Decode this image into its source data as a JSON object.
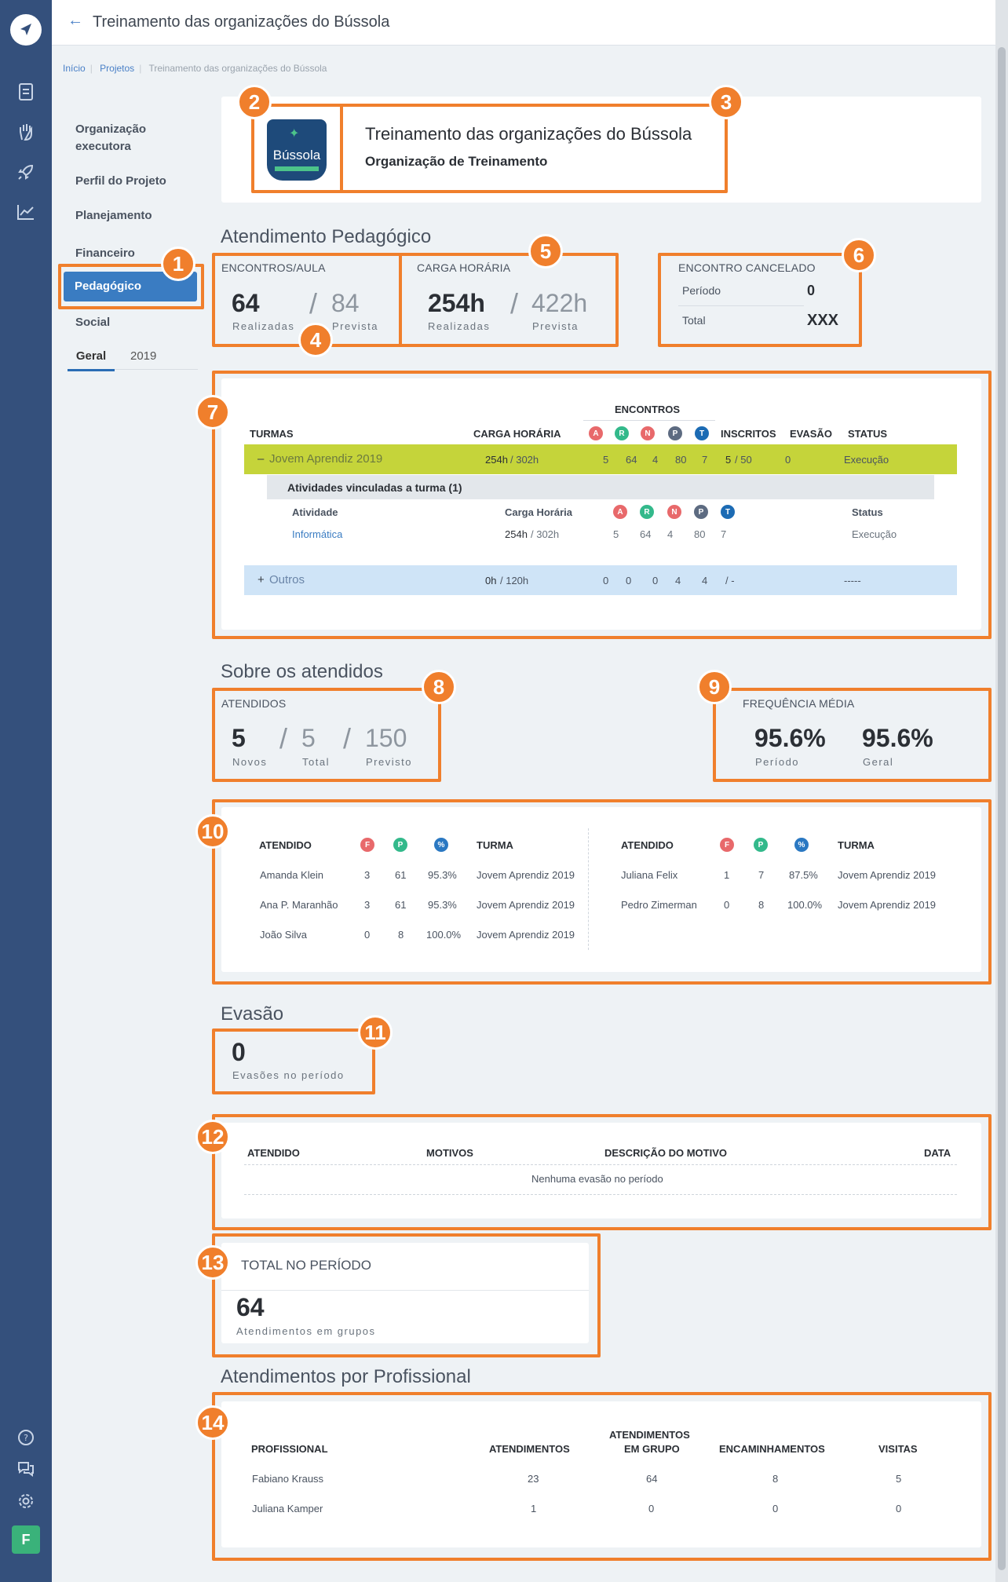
{
  "header": {
    "title": "Treinamento das organizações do Bússola"
  },
  "breadcrumb": [
    "Início",
    "Projetos",
    "Treinamento das organizações do Bússola"
  ],
  "menu": {
    "items": [
      "Organização executora",
      "Perfil do Projeto",
      "Planejamento",
      "Financeiro",
      "Pedagógico",
      "Social"
    ],
    "active": "Pedagógico",
    "toggle": [
      "Geral",
      "2019"
    ]
  },
  "org": {
    "logo_text": "Bússola",
    "name": "Treinamento das organizações do Bússola",
    "type": "Organização de Treinamento"
  },
  "atendimento": {
    "title": "Atendimento Pedagógico",
    "encontros": {
      "label": "ENCONTROS/AULA",
      "realizadas": "64",
      "prevista": "84",
      "realizadas_label": "Realizadas",
      "prevista_label": "Prevista"
    },
    "carga": {
      "label": "CARGA HORÁRIA",
      "realizadas": "254h",
      "prevista": "422h",
      "realizadas_label": "Realizadas",
      "prevista_label": "Prevista"
    },
    "cancelado": {
      "label": "ENCONTRO CANCELADO",
      "periodo_label": "Período",
      "periodo": "0",
      "total_label": "Total",
      "total": "XXX"
    }
  },
  "turmas": {
    "headers": {
      "turmas": "TURMAS",
      "carga": "CARGA HORÁRIA",
      "encontros": "ENCONTROS",
      "inscritos": "INSCRITOS",
      "evasao": "EVASÃO",
      "status": "STATUS"
    },
    "letters": [
      "A",
      "R",
      "N",
      "P",
      "T"
    ],
    "row1": {
      "toggle": "–",
      "name": "Jovem Aprendiz 2019",
      "carga_a": "254h",
      "carga_b": "/ 302h",
      "enc": [
        "5",
        "64",
        "4",
        "80",
        "7"
      ],
      "ins_a": "5",
      "ins_b": "/ 50",
      "evasao": "0",
      "status": "Execução"
    },
    "sub_title": "Atividades vinculadas a turma (1)",
    "sub_headers": {
      "atividade": "Atividade",
      "carga": "Carga Horária",
      "status": "Status"
    },
    "sub_row": {
      "name": "Informática",
      "carga_a": "254h",
      "carga_b": "/ 302h",
      "enc": [
        "5",
        "64",
        "4",
        "80",
        "7"
      ],
      "status": "Execução"
    },
    "row2": {
      "toggle": "+",
      "name": "Outros",
      "carga_a": "0h",
      "carga_b": "/ 120h",
      "enc": [
        "0",
        "0",
        "0",
        "4",
        "4"
      ],
      "ins": "/ -",
      "status": "-----"
    }
  },
  "sobre": {
    "title": "Sobre os atendidos",
    "atendidos": {
      "label": "ATENDIDOS",
      "novos": "5",
      "total": "5",
      "previsto": "150",
      "novos_label": "Novos",
      "total_label": "Total",
      "previsto_label": "Previsto"
    },
    "freq": {
      "label": "FREQUÊNCIA MÉDIA",
      "periodo": "95.6%",
      "geral": "95.6%",
      "periodo_label": "Período",
      "geral_label": "Geral"
    }
  },
  "atendidos_table": {
    "headers": {
      "atendido": "ATENDIDO",
      "f": "F",
      "p": "P",
      "pct": "%",
      "turma": "TURMA"
    },
    "left": [
      {
        "name": "Amanda Klein",
        "f": "3",
        "p": "61",
        "pct": "95.3%",
        "turma": "Jovem Aprendiz 2019"
      },
      {
        "name": "Ana P. Maranhão",
        "f": "3",
        "p": "61",
        "pct": "95.3%",
        "turma": "Jovem Aprendiz 2019"
      },
      {
        "name": "João Silva",
        "f": "0",
        "p": "8",
        "pct": "100.0%",
        "turma": "Jovem Aprendiz 2019"
      }
    ],
    "right": [
      {
        "name": "Juliana Felix",
        "f": "1",
        "p": "7",
        "pct": "87.5%",
        "turma": "Jovem Aprendiz 2019"
      },
      {
        "name": "Pedro Zimerman",
        "f": "0",
        "p": "8",
        "pct": "100.0%",
        "turma": "Jovem Aprendiz 2019"
      }
    ]
  },
  "evasao": {
    "title": "Evasão",
    "value": "0",
    "value_label": "Evasões no período",
    "headers": {
      "atendido": "ATENDIDO",
      "motivos": "MOTIVOS",
      "descricao": "DESCRIÇÃO DO MOTIVO",
      "data": "DATA"
    },
    "empty": "Nenhuma evasão no período"
  },
  "total": {
    "title": "TOTAL NO PERÍODO",
    "value": "64",
    "label": "Atendimentos em grupos"
  },
  "profissional": {
    "title": "Atendimentos por Profissional",
    "headers": {
      "profissional": "PROFISSIONAL",
      "atendimentos": "ATENDIMENTOS",
      "grupo_a": "ATENDIMENTOS",
      "grupo_b": "EM GRUPO",
      "encaminhamentos": "ENCAMINHAMENTOS",
      "visitas": "VISITAS"
    },
    "rows": [
      {
        "name": "Fabiano Krauss",
        "atendimentos": "23",
        "grupo": "64",
        "encaminhamentos": "8",
        "visitas": "5"
      },
      {
        "name": "Juliana Kamper",
        "atendimentos": "1",
        "grupo": "0",
        "encaminhamentos": "0",
        "visitas": "0"
      }
    ]
  },
  "badges": [
    "1",
    "2",
    "3",
    "4",
    "5",
    "6",
    "7",
    "8",
    "9",
    "10",
    "11",
    "12",
    "13",
    "14"
  ],
  "user": {
    "initial": "F"
  },
  "colors": {
    "accent": "#f07f2c",
    "primary": "#3a7cc2",
    "sidebar": "#34507c",
    "highlight_row": "#c5d43a",
    "other_row": "#cfe4f7"
  }
}
